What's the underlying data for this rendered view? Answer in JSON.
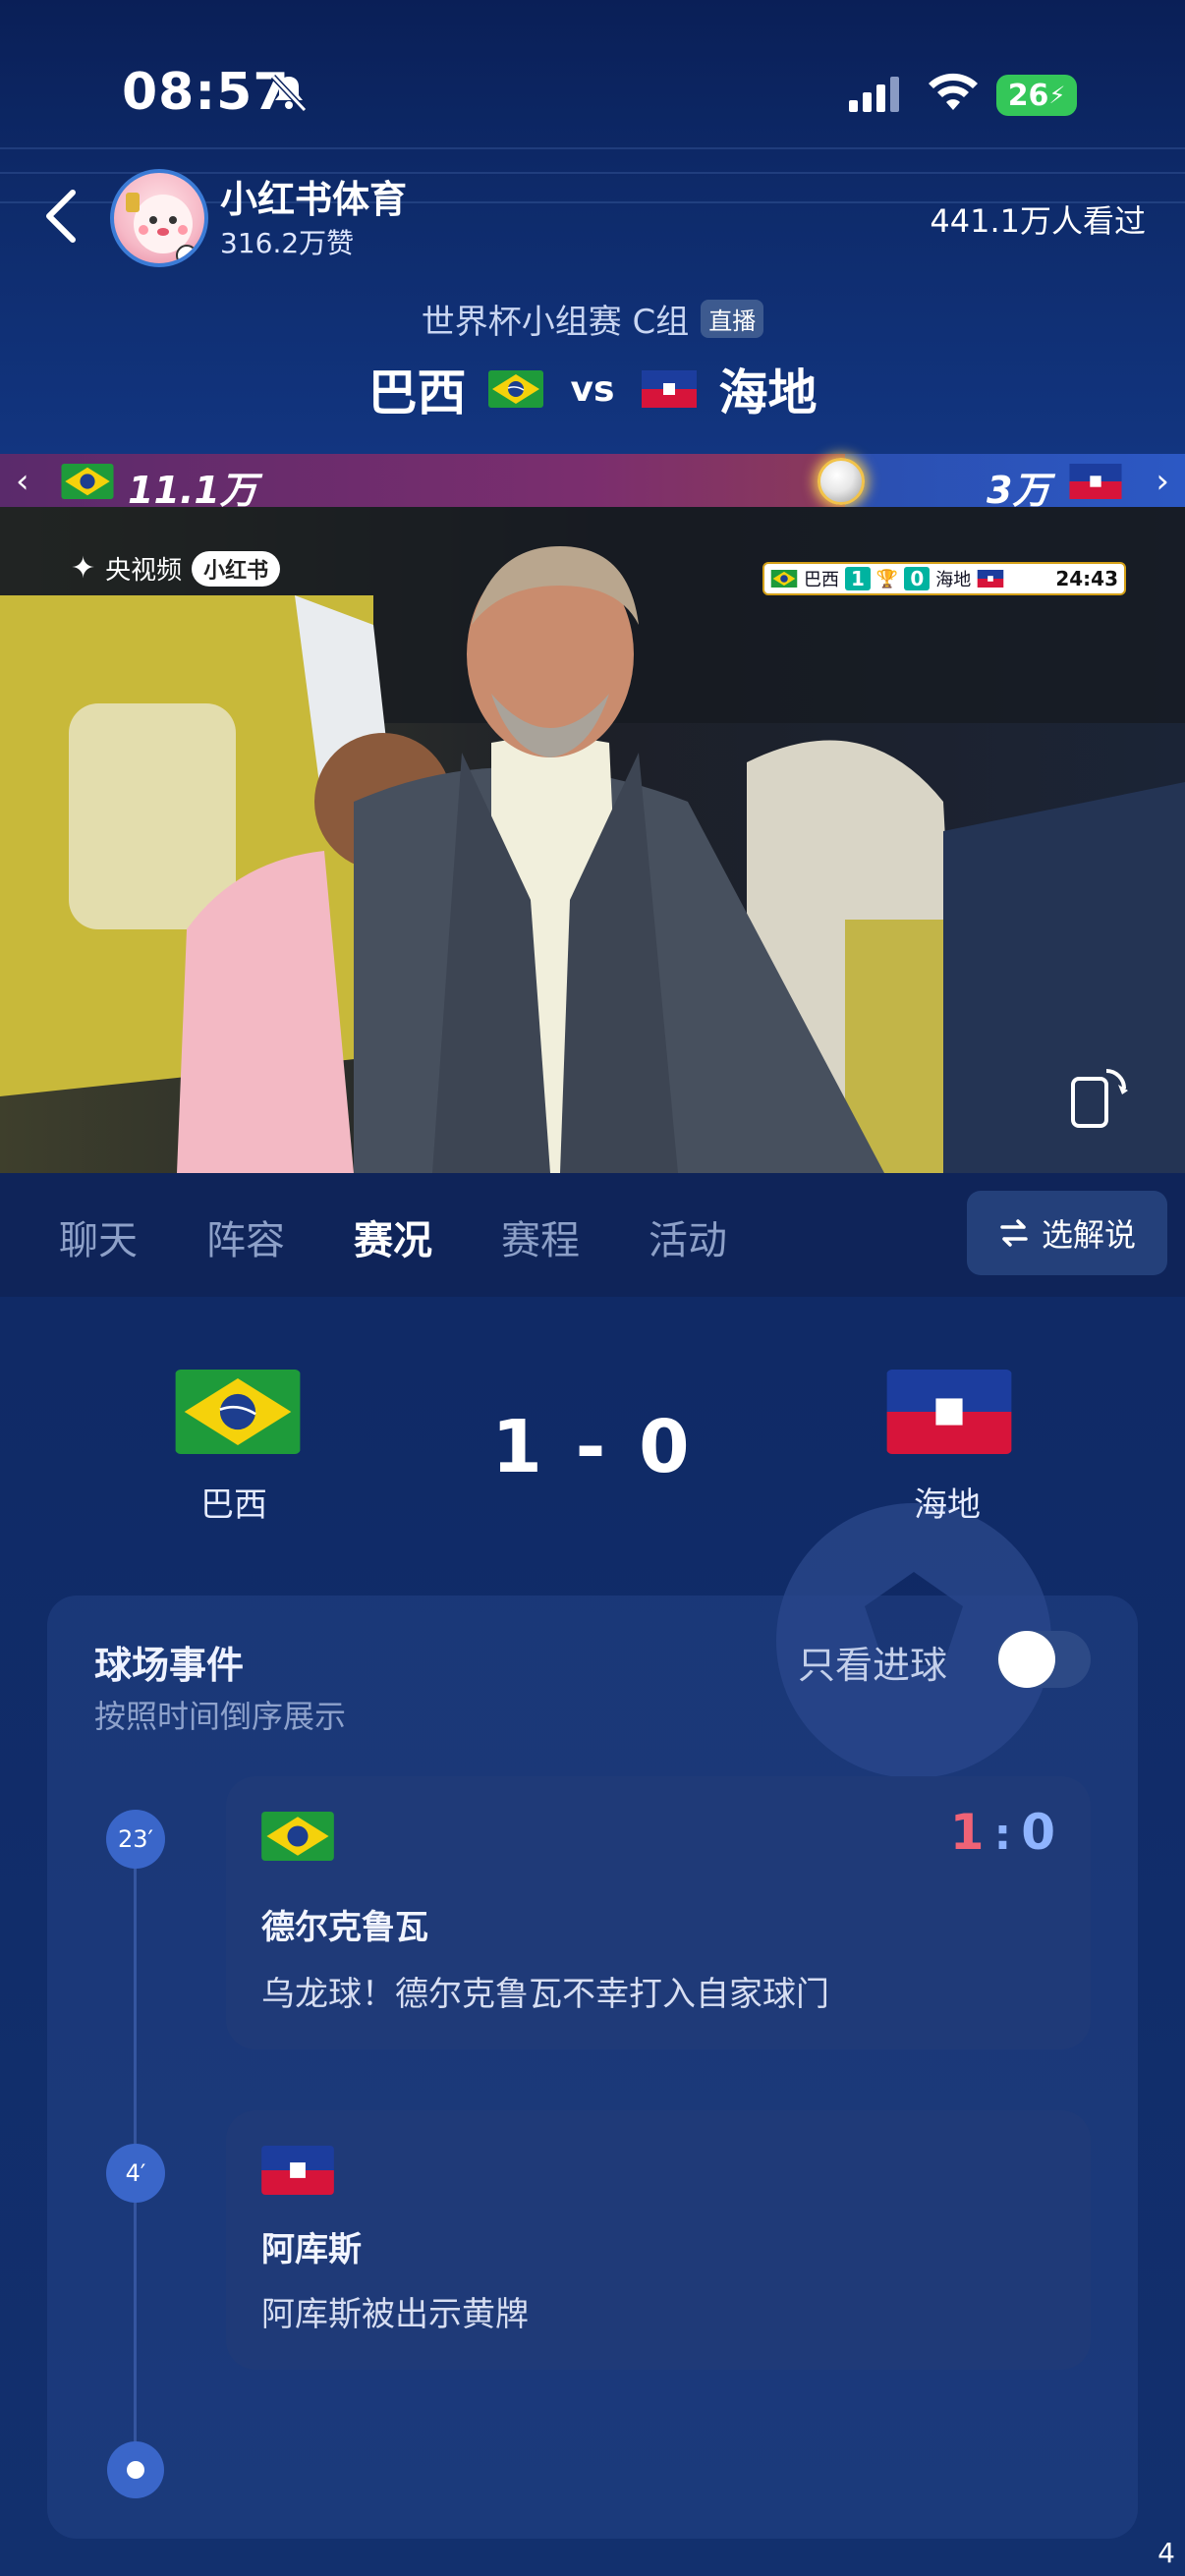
{
  "status_bar": {
    "time": "08:57",
    "battery": "26"
  },
  "channel": {
    "name": "小红书体育",
    "likes": "316.2万赞",
    "views": "441.1万人看过"
  },
  "match": {
    "stage": "世界杯小组赛 C组",
    "live_badge": "直播",
    "home": "巴西",
    "vs": "vs",
    "away": "海地"
  },
  "support": {
    "home_count": "11.1万",
    "away_count": "3万"
  },
  "video": {
    "broadcaster": "央视频",
    "watermark": "小红书",
    "scoreboard": {
      "home": "巴西",
      "home_score": "1",
      "away_score": "0",
      "away": "海地",
      "clock": "24:43"
    }
  },
  "tabs": [
    {
      "label": "聊天",
      "active": false
    },
    {
      "label": "阵容",
      "active": false
    },
    {
      "label": "赛况",
      "active": true
    },
    {
      "label": "赛程",
      "active": false
    },
    {
      "label": "活动",
      "active": false
    }
  ],
  "commentary_button": "选解说",
  "scoreline": {
    "home_name": "巴西",
    "away_name": "海地",
    "score": "1 - 0"
  },
  "events": {
    "title": "球场事件",
    "subtitle": "按照时间倒序展示",
    "goals_only_label": "只看进球",
    "goals_only_enabled": false,
    "items": [
      {
        "minute": "23′",
        "team": "brazil",
        "player": "德尔克鲁瓦",
        "desc": "乌龙球！德尔克鲁瓦不幸打入自家球门",
        "score_home": "1",
        "score_sep": ":",
        "score_away": "0"
      },
      {
        "minute": "4′",
        "team": "haiti",
        "player": "阿库斯",
        "desc": "阿库斯被出示黄牌"
      }
    ]
  },
  "page_number": "4",
  "colors": {
    "background": "#0f2459",
    "accent": "#3a66c9",
    "home_score": "#f06376",
    "away_score": "#8fb4ff"
  },
  "icons": [
    "mute-icon",
    "signal-icon",
    "wifi-icon",
    "back-icon",
    "football-icon",
    "rotate-screen-icon",
    "swap-icon"
  ]
}
